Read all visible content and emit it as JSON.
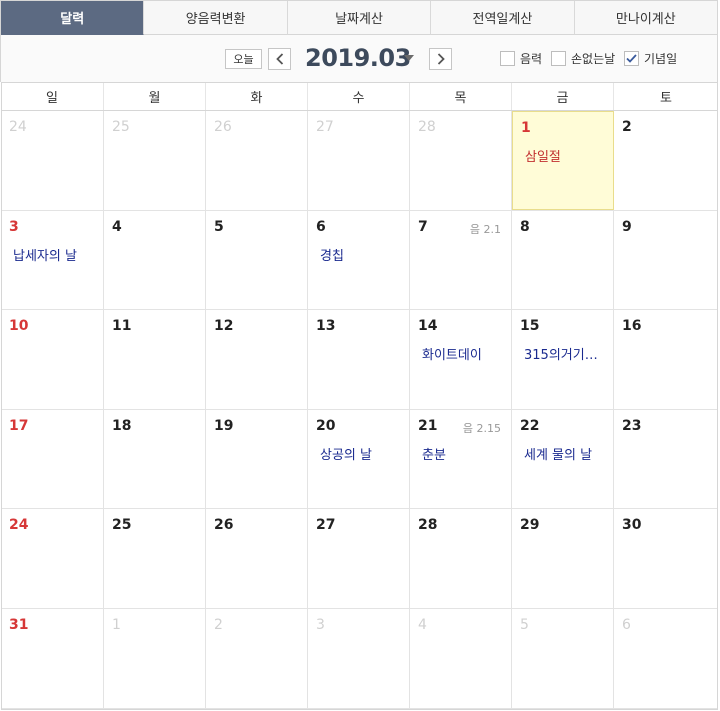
{
  "tabs": [
    {
      "label": "달력",
      "active": true
    },
    {
      "label": "양음력변환",
      "active": false
    },
    {
      "label": "날짜계산",
      "active": false
    },
    {
      "label": "전역일계산",
      "active": false
    },
    {
      "label": "만나이계산",
      "active": false
    }
  ],
  "toolbar": {
    "today_label": "오늘",
    "month_title": "2019.03",
    "options": {
      "lunar_label": "음력",
      "lunar_checked": false,
      "sonnal_label": "손없는날",
      "sonnal_checked": false,
      "anniv_label": "기념일",
      "anniv_checked": true
    }
  },
  "weekdays": [
    "일",
    "월",
    "화",
    "수",
    "목",
    "금",
    "토"
  ],
  "weeks": [
    [
      {
        "day": "24",
        "other": true
      },
      {
        "day": "25",
        "other": true
      },
      {
        "day": "26",
        "other": true
      },
      {
        "day": "27",
        "other": true
      },
      {
        "day": "28",
        "other": true
      },
      {
        "day": "1",
        "holiday": true,
        "highlight": true,
        "event": "삼일절",
        "event_red": true
      },
      {
        "day": "2"
      }
    ],
    [
      {
        "day": "3",
        "sun": true,
        "event": "납세자의 날"
      },
      {
        "day": "4"
      },
      {
        "day": "5"
      },
      {
        "day": "6",
        "event": "경칩"
      },
      {
        "day": "7",
        "lunar": "음 2.1"
      },
      {
        "day": "8"
      },
      {
        "day": "9"
      }
    ],
    [
      {
        "day": "10",
        "sun": true
      },
      {
        "day": "11"
      },
      {
        "day": "12"
      },
      {
        "day": "13"
      },
      {
        "day": "14",
        "event": "화이트데이"
      },
      {
        "day": "15",
        "event": "315의거기…"
      },
      {
        "day": "16"
      }
    ],
    [
      {
        "day": "17",
        "sun": true
      },
      {
        "day": "18"
      },
      {
        "day": "19"
      },
      {
        "day": "20",
        "event": "상공의 날"
      },
      {
        "day": "21",
        "lunar": "음 2.15",
        "event": "춘분"
      },
      {
        "day": "22",
        "event": "세계 물의 날"
      },
      {
        "day": "23"
      }
    ],
    [
      {
        "day": "24",
        "sun": true
      },
      {
        "day": "25"
      },
      {
        "day": "26"
      },
      {
        "day": "27"
      },
      {
        "day": "28"
      },
      {
        "day": "29"
      },
      {
        "day": "30"
      }
    ],
    [
      {
        "day": "31",
        "sun": true
      },
      {
        "day": "1",
        "other": true
      },
      {
        "day": "2",
        "other": true
      },
      {
        "day": "3",
        "other": true
      },
      {
        "day": "4",
        "other": true
      },
      {
        "day": "5",
        "other": true
      },
      {
        "day": "6",
        "other": true
      }
    ]
  ],
  "colors": {
    "active_tab": "#5c6a82",
    "sunday": "#d63737",
    "event": "#1a2a8f",
    "holiday_event": "#c23030",
    "highlight": "#fffcd7"
  }
}
